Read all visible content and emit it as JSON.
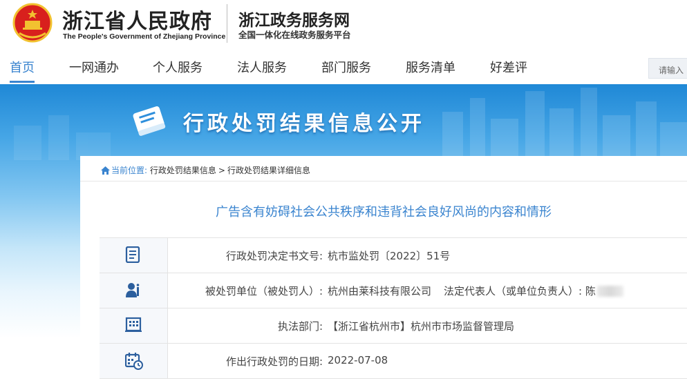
{
  "header": {
    "gov_title": "浙江省人民政府",
    "gov_subtitle": "The People's Government of Zhejiang Province",
    "portal_title": "浙江政务服务网",
    "portal_subtitle": "全国一体化在线政务服务平台"
  },
  "nav": {
    "items": [
      {
        "label": "首页",
        "active": true
      },
      {
        "label": "一网通办"
      },
      {
        "label": "个人服务"
      },
      {
        "label": "法人服务"
      },
      {
        "label": "部门服务"
      },
      {
        "label": "服务清单"
      },
      {
        "label": "好差评"
      }
    ],
    "search_placeholder": "请输入"
  },
  "banner": {
    "title": "行政处罚结果信息公开",
    "icon": "book-icon"
  },
  "breadcrumb": {
    "label": "当前位置:",
    "items": [
      "行政处罚结果信息",
      "行政处罚结果详细信息"
    ],
    "separator": ">"
  },
  "article": {
    "title": "广告含有妨碍社会公共秩序和违背社会良好风尚的内容和情形"
  },
  "rows": [
    {
      "icon": "document-icon",
      "label": "行政处罚决定书文号:",
      "value": "杭市监处罚〔2022〕51号"
    },
    {
      "icon": "person-icon",
      "label": "被处罚单位（被处罚人）:",
      "value": "杭州由莱科技有限公司",
      "extra_label": "法定代表人（或单位负责人）:",
      "extra_value": "陈"
    },
    {
      "icon": "building-icon",
      "label": "执法部门:",
      "value": "【浙江省杭州市】杭州市市场监督管理局"
    },
    {
      "icon": "calendar-icon",
      "label": "作出行政处罚的日期:",
      "value": "2022-07-08"
    }
  ],
  "colors": {
    "accent": "#3a84cf",
    "emblem_red": "#d8201d",
    "gold": "#f2c230"
  }
}
